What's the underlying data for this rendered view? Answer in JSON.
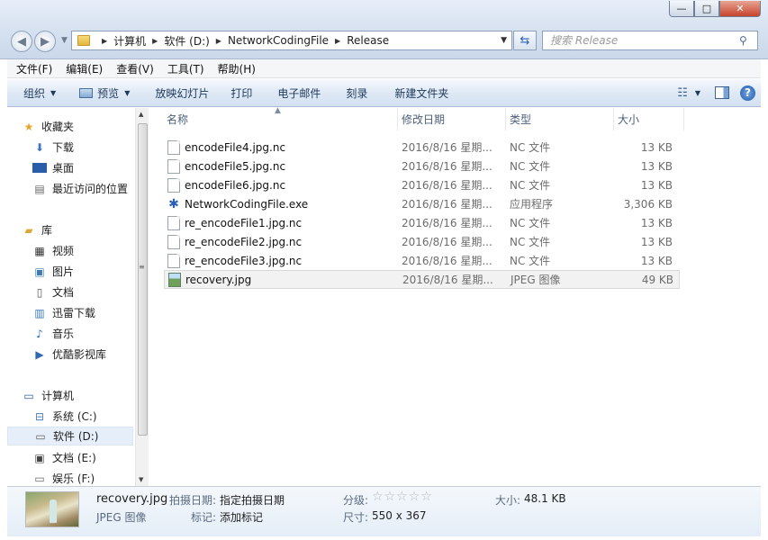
{
  "window": {
    "minimize": "—",
    "maximize": "□",
    "close": "✕"
  },
  "address": {
    "crumbs": [
      "计算机",
      "软件 (D:)",
      "NetworkCodingFile",
      "Release"
    ]
  },
  "search": {
    "placeholder": "搜索 Release"
  },
  "menu": [
    "文件(F)",
    "编辑(E)",
    "查看(V)",
    "工具(T)",
    "帮助(H)"
  ],
  "commands": {
    "organize": "组织",
    "preview": "预览",
    "slideshow": "放映幻灯片",
    "print": "打印",
    "email": "电子邮件",
    "burn": "刻录",
    "new_folder": "新建文件夹"
  },
  "nav": {
    "favorites": "收藏夹",
    "downloads": "下载",
    "desktop": "桌面",
    "recent": "最近访问的位置",
    "libraries": "库",
    "videos": "视频",
    "pictures": "图片",
    "documents": "文档",
    "xunlei": "迅雷下载",
    "music": "音乐",
    "youku": "优酷影视库",
    "computer": "计算机",
    "drive_c": "系统 (C:)",
    "drive_d": "软件 (D:)",
    "drive_e": "文档 (E:)",
    "drive_f": "娱乐 (F:)"
  },
  "columns": {
    "name": "名称",
    "date": "修改日期",
    "type": "类型",
    "size": "大小"
  },
  "files": [
    {
      "name": "encodeFile4.jpg.nc",
      "date": "2016/8/16 星期...",
      "type": "NC 文件",
      "size": "13 KB",
      "icon": "doc"
    },
    {
      "name": "encodeFile5.jpg.nc",
      "date": "2016/8/16 星期...",
      "type": "NC 文件",
      "size": "13 KB",
      "icon": "doc"
    },
    {
      "name": "encodeFile6.jpg.nc",
      "date": "2016/8/16 星期...",
      "type": "NC 文件",
      "size": "13 KB",
      "icon": "doc"
    },
    {
      "name": "NetworkCodingFile.exe",
      "date": "2016/8/16 星期...",
      "type": "应用程序",
      "size": "3,306 KB",
      "icon": "exe"
    },
    {
      "name": "re_encodeFile1.jpg.nc",
      "date": "2016/8/16 星期...",
      "type": "NC 文件",
      "size": "13 KB",
      "icon": "doc"
    },
    {
      "name": "re_encodeFile2.jpg.nc",
      "date": "2016/8/16 星期...",
      "type": "NC 文件",
      "size": "13 KB",
      "icon": "doc"
    },
    {
      "name": "re_encodeFile3.jpg.nc",
      "date": "2016/8/16 星期...",
      "type": "NC 文件",
      "size": "13 KB",
      "icon": "doc"
    },
    {
      "name": "recovery.jpg",
      "date": "2016/8/16 星期...",
      "type": "JPEG 图像",
      "size": "49 KB",
      "icon": "jpg"
    }
  ],
  "details": {
    "filename": "recovery.jpg",
    "filetype": "JPEG 图像",
    "date_label": "拍摄日期:",
    "date_value": "指定拍摄日期",
    "tags_label": "标记:",
    "tags_value": "添加标记",
    "rating_label": "分级:",
    "rating_stars": 0,
    "rating_max": 5,
    "dims_label": "尺寸:",
    "dims_value": "550 x 367",
    "size_label": "大小:",
    "size_value": "48.1 KB"
  }
}
